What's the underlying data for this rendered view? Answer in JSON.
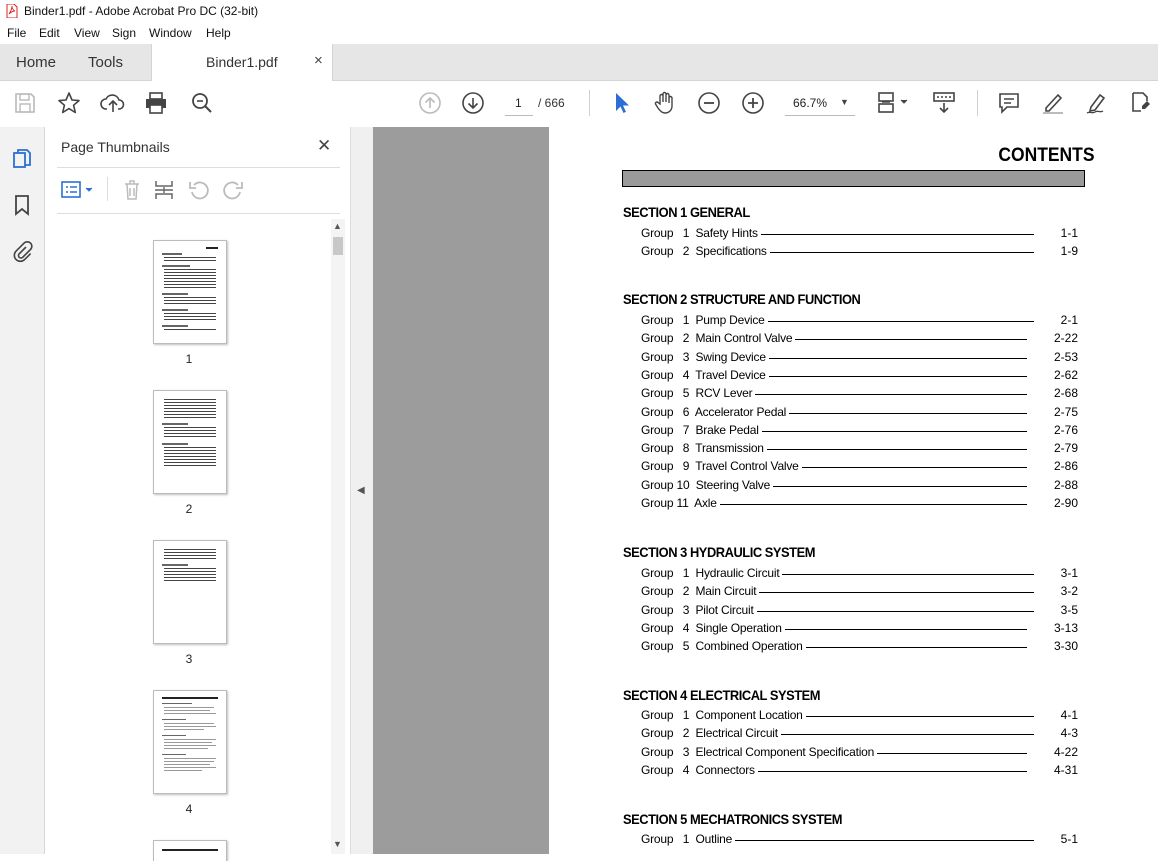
{
  "window": {
    "title": "Binder1.pdf - Adobe Acrobat Pro DC (32-bit)"
  },
  "menu": [
    "File",
    "Edit",
    "View",
    "Sign",
    "Window",
    "Help"
  ],
  "tabs": {
    "home": "Home",
    "tools": "Tools",
    "document": "Binder1.pdf",
    "close": "×"
  },
  "toolbar": {
    "current_page": "1",
    "page_total": "/ 666",
    "zoom": "66.7%"
  },
  "panel": {
    "title": "Page Thumbnails",
    "close": "✕",
    "thumb_labels": [
      "1",
      "2",
      "3",
      "4"
    ]
  },
  "document": {
    "heading": "CONTENTS",
    "sections": [
      {
        "title": "SECTION 1  GENERAL",
        "groups": [
          {
            "label": "Group   1  Safety Hints",
            "page": "1-1"
          },
          {
            "label": "Group   2  Specifications",
            "page": "1-9"
          }
        ]
      },
      {
        "title": "SECTION 2  STRUCTURE AND FUNCTION",
        "groups": [
          {
            "label": "Group   1  Pump Device",
            "page": "2-1"
          },
          {
            "label": "Group   2  Main Control Valve",
            "page": "2-22"
          },
          {
            "label": "Group   3  Swing Device",
            "page": "2-53"
          },
          {
            "label": "Group   4  Travel Device",
            "page": "2-62"
          },
          {
            "label": "Group   5  RCV Lever",
            "page": "2-68"
          },
          {
            "label": "Group   6  Accelerator Pedal",
            "page": "2-75"
          },
          {
            "label": "Group   7  Brake Pedal",
            "page": "2-76"
          },
          {
            "label": "Group   8  Transmission",
            "page": "2-79"
          },
          {
            "label": "Group   9  Travel Control Valve",
            "page": "2-86"
          },
          {
            "label": "Group 10  Steering Valve",
            "page": "2-88"
          },
          {
            "label": "Group 11  Axle",
            "page": "2-90"
          }
        ]
      },
      {
        "title": "SECTION 3  HYDRAULIC SYSTEM",
        "groups": [
          {
            "label": "Group   1  Hydraulic Circuit",
            "page": "3-1"
          },
          {
            "label": "Group   2  Main Circuit",
            "page": "3-2"
          },
          {
            "label": "Group   3  Pilot Circuit",
            "page": "3-5"
          },
          {
            "label": "Group   4  Single Operation",
            "page": "3-13"
          },
          {
            "label": "Group   5  Combined Operation",
            "page": "3-30"
          }
        ]
      },
      {
        "title": "SECTION 4  ELECTRICAL SYSTEM",
        "groups": [
          {
            "label": "Group   1  Component Location",
            "page": "4-1"
          },
          {
            "label": "Group   2  Electrical Circuit",
            "page": "4-3"
          },
          {
            "label": "Group   3  Electrical Component Specification",
            "page": "4-22"
          },
          {
            "label": "Group   4  Connectors",
            "page": "4-31"
          }
        ]
      },
      {
        "title": "SECTION 5  MECHATRONICS SYSTEM",
        "groups": [
          {
            "label": "Group   1  Outline",
            "page": "5-1"
          }
        ]
      }
    ]
  },
  "colors": {
    "accent": "#2b6fd6",
    "tabbar": "#e6e6e6",
    "page_bg": "#9c9c9c"
  }
}
